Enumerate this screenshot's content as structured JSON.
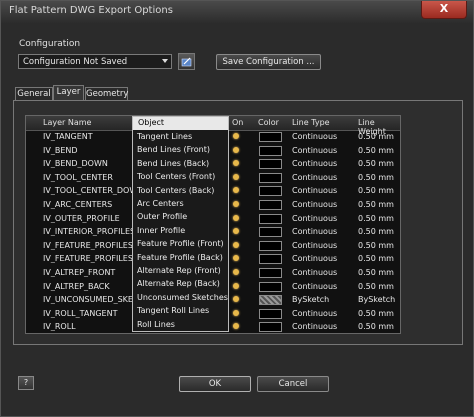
{
  "window": {
    "title": "Flat Pattern DWG Export Options",
    "close_glyph": "X"
  },
  "configuration": {
    "label": "Configuration",
    "selected": "Configuration Not Saved",
    "save_button": "Save Configuration ..."
  },
  "tabs": [
    {
      "label": "General"
    },
    {
      "label": "Layer"
    },
    {
      "label": "Geometry"
    }
  ],
  "active_tab": "Layer",
  "grid": {
    "columns": {
      "layer_name": "Layer Name",
      "object": "Object",
      "on": "On",
      "color": "Color",
      "line_type": "Line Type",
      "line_weight": "Line Weight"
    },
    "rows": [
      {
        "layer": "IV_TANGENT",
        "line_type": "Continuous",
        "line_weight": "0.50 mm",
        "color": "black"
      },
      {
        "layer": "IV_BEND",
        "line_type": "Continuous",
        "line_weight": "0.50 mm",
        "color": "black"
      },
      {
        "layer": "IV_BEND_DOWN",
        "line_type": "Continuous",
        "line_weight": "0.50 mm",
        "color": "black"
      },
      {
        "layer": "IV_TOOL_CENTER",
        "line_type": "Continuous",
        "line_weight": "0.50 mm",
        "color": "black"
      },
      {
        "layer": "IV_TOOL_CENTER_DOW",
        "line_type": "Continuous",
        "line_weight": "0.50 mm",
        "color": "black"
      },
      {
        "layer": "IV_ARC_CENTERS",
        "line_type": "Continuous",
        "line_weight": "0.50 mm",
        "color": "black"
      },
      {
        "layer": "IV_OUTER_PROFILE",
        "line_type": "Continuous",
        "line_weight": "0.50 mm",
        "color": "black"
      },
      {
        "layer": "IV_INTERIOR_PROFILES",
        "line_type": "Continuous",
        "line_weight": "0.50 mm",
        "color": "black"
      },
      {
        "layer": "IV_FEATURE_PROFILES",
        "line_type": "Continuous",
        "line_weight": "0.50 mm",
        "color": "black"
      },
      {
        "layer": "IV_FEATURE_PROFILES",
        "line_type": "Continuous",
        "line_weight": "0.50 mm",
        "color": "black"
      },
      {
        "layer": "IV_ALTREP_FRONT",
        "line_type": "Continuous",
        "line_weight": "0.50 mm",
        "color": "black"
      },
      {
        "layer": "IV_ALTREP_BACK",
        "line_type": "Continuous",
        "line_weight": "0.50 mm",
        "color": "black"
      },
      {
        "layer": "IV_UNCONSUMED_SKETC",
        "line_type": "BySketch",
        "line_weight": "BySketch",
        "color": "hatched"
      },
      {
        "layer": "IV_ROLL_TANGENT",
        "line_type": "Continuous",
        "line_weight": "0.50 mm",
        "color": "black"
      },
      {
        "layer": "IV_ROLL",
        "line_type": "Continuous",
        "line_weight": "0.50 mm",
        "color": "black"
      }
    ]
  },
  "object_popup": {
    "title": "Object",
    "items": [
      "Tangent Lines",
      "Bend Lines (Front)",
      "Bend Lines (Back)",
      "Tool Centers (Front)",
      "Tool Centers (Back)",
      "Arc Centers",
      "Outer Profile",
      "Inner Profile",
      "Feature Profile (Front)",
      "Feature Profile (Back)",
      "Alternate Rep (Front)",
      "Alternate Rep (Back)",
      "Unconsumed Sketches",
      "Tangent Roll Lines",
      "Roll Lines"
    ]
  },
  "footer": {
    "help_glyph": "?",
    "ok": "OK",
    "cancel": "Cancel"
  }
}
